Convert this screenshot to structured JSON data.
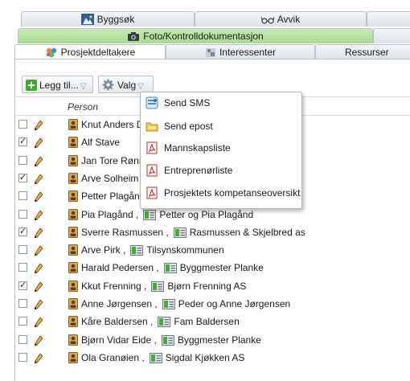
{
  "tabs": {
    "row1": [
      "Byggsøk",
      "Avvik"
    ],
    "row2": [
      "Foto/Kontrolldokumentasjon"
    ],
    "row3": [
      "Prosjektdeltakere",
      "Interessenter",
      "Ressurser"
    ]
  },
  "toolbar": {
    "add_label": "Legg til...",
    "options_label": "Valg"
  },
  "table": {
    "person_header": "Person",
    "rows": [
      {
        "name": "Knut Anders D",
        "checked": false,
        "company": ""
      },
      {
        "name": "Alf Stave",
        "checked": true,
        "company": ""
      },
      {
        "name": "Jan Tore Rønn",
        "checked": false,
        "company": ""
      },
      {
        "name": "Arve Solheim",
        "checked": true,
        "company": ""
      },
      {
        "name": "Petter Plagån",
        "checked": false,
        "company": ""
      },
      {
        "name": "Pia Plagånd",
        "checked": false,
        "company": "Petter og Pia Plagånd"
      },
      {
        "name": "Sverre Rasmussen",
        "checked": true,
        "company": "Rasmussen & Skjelbred as"
      },
      {
        "name": "Arve Pirk",
        "checked": false,
        "company": "Tilsynskommunen"
      },
      {
        "name": "Harald Pedersen",
        "checked": false,
        "company": "Byggmester Planke"
      },
      {
        "name": "Kkut Frenning",
        "checked": true,
        "company": "Bjørn Frenning AS"
      },
      {
        "name": "Anne Jørgensen",
        "checked": false,
        "company": "Peder og Anne Jørgensen"
      },
      {
        "name": "Kåre Baldersen",
        "checked": false,
        "company": "Fam Baldersen"
      },
      {
        "name": "Bjørn Vidar Eide",
        "checked": false,
        "company": "Byggmester Planke"
      },
      {
        "name": "Ola Granøien",
        "checked": false,
        "company": "Sigdal Kjøkken AS"
      }
    ]
  },
  "menu": {
    "items": [
      {
        "label": "Send SMS",
        "icon": "sms-icon"
      },
      {
        "label": "Send epost",
        "icon": "email-icon"
      },
      {
        "label": "Mannskapsliste",
        "icon": "pdf-icon"
      },
      {
        "label": "Entreprenørliste",
        "icon": "pdf-icon"
      },
      {
        "label": "Prosjektets kompetanseoversikt",
        "icon": "pdf-icon"
      }
    ]
  },
  "colors": {
    "green_tab": "#a9d98e",
    "border": "#b9c1c9",
    "add_icon": "#3ea832"
  }
}
